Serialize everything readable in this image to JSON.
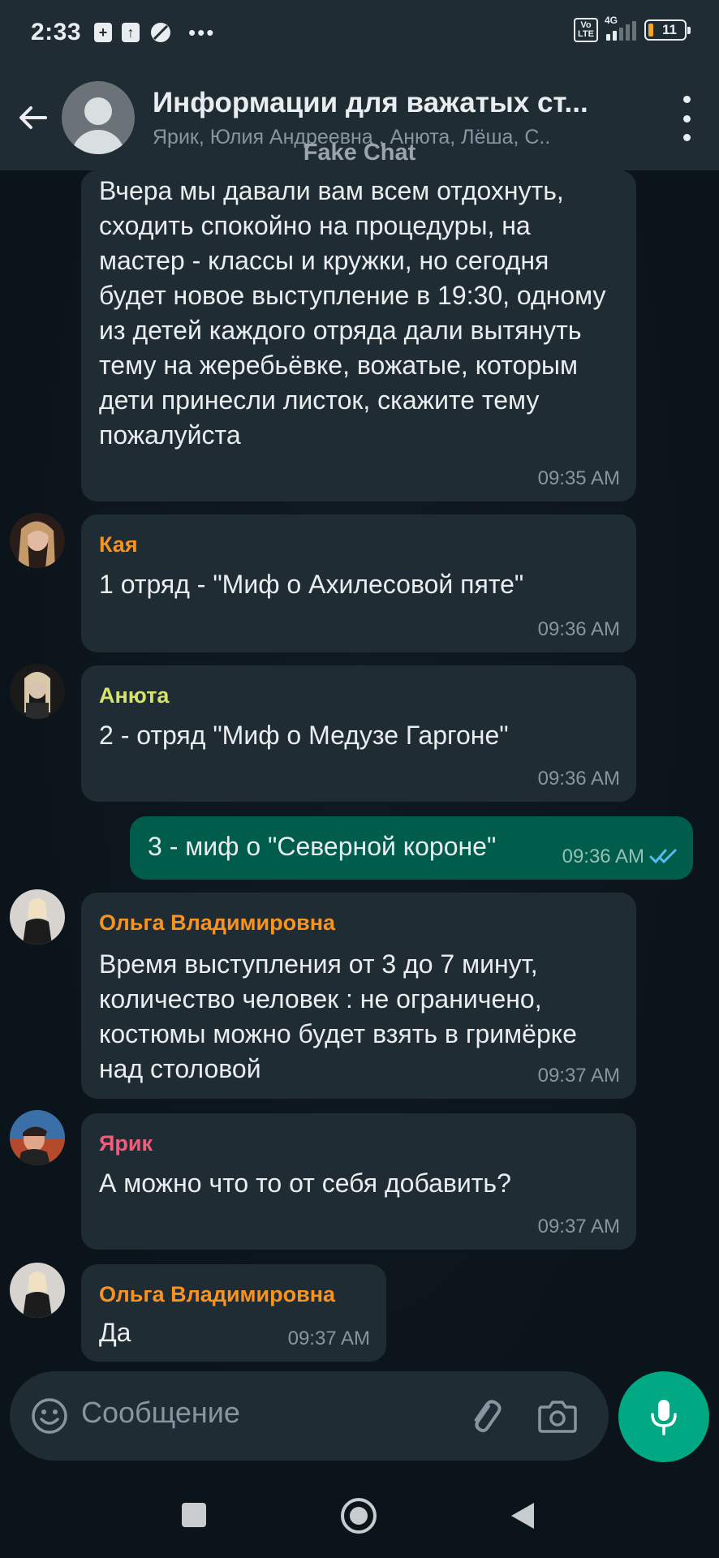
{
  "status": {
    "time": "2:33",
    "battery": "11",
    "network": "4G",
    "volte": "Vo LTE"
  },
  "header": {
    "title": "Информации для важатых ст...",
    "subtitle": "Ярик, Юлия Андреевна , Анюта, Лёша, С..",
    "watermark": "Fake Chat"
  },
  "messages": [
    {
      "direction": "in",
      "sender": "",
      "text": "Вчера мы давали вам всем отдохнуть, сходить спокойно на процедуры, на мастер - классы и кружки, но сегодня будет новое выступление в 19:30, одному из детей каждого отряда дали вытянуть тему на жеребьёвке, вожатые, которым дети принесли листок, скажите тему пожалуйста",
      "time": "09:35 AM"
    },
    {
      "direction": "in",
      "sender": "Кая",
      "sender_color": "#f7931e",
      "text": "1 отряд - \"Миф о Ахилесовой пяте\"",
      "time": "09:36 AM"
    },
    {
      "direction": "in",
      "sender": "Анюта",
      "sender_color": "#d6e26d",
      "text": "2 - отряд \"Миф о Медузе Гаргоне\"",
      "time": "09:36 AM"
    },
    {
      "direction": "out",
      "sender": "",
      "text": "3 - миф о \"Северной короне\"",
      "time": "09:36 AM",
      "status": "read-double-check"
    },
    {
      "direction": "in",
      "sender": "Ольга Владимировна",
      "sender_color": "#f7931e",
      "text": "Время выступления от 3 до 7 минут, количество человек : не ограничено, костюмы можно будет взять в гримёрке над столовой",
      "time": "09:37 AM"
    },
    {
      "direction": "in",
      "sender": "Ярик",
      "sender_color": "#f15c7c",
      "text": "А можно что то от себя добавить?",
      "time": "09:37 AM"
    },
    {
      "direction": "in",
      "sender": "Ольга Владимировна",
      "sender_color": "#f7931e",
      "text": "Да",
      "time": "09:37 AM"
    }
  ],
  "input": {
    "placeholder": "Сообщение"
  },
  "icons": {
    "back": "arrow-left-icon",
    "menu": "more-vert-icon",
    "emoji": "smiley-icon",
    "attach": "paperclip-icon",
    "camera": "camera-icon",
    "mic": "microphone-icon",
    "nav_recent": "square-icon",
    "nav_home": "circle-icon",
    "nav_back": "triangle-back-icon"
  },
  "colors": {
    "bg": "#0b141a",
    "bar": "#1f2c34",
    "bubble_in": "#202c33",
    "bubble_out": "#005c4b",
    "accent": "#00a884",
    "read_tick": "#53bdeb"
  }
}
